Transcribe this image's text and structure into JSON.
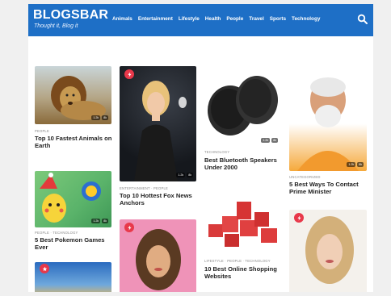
{
  "header": {
    "logo": "BLOGSBAR",
    "tagline": "Thought it, Blog it",
    "nav": [
      "Animals",
      "Entertainment",
      "Lifestyle",
      "Health",
      "People",
      "Travel",
      "Sports",
      "Technology"
    ],
    "search_icon": "search-icon",
    "bg_color": "#1e6fc6"
  },
  "posts": {
    "lion": {
      "category": "PEOPLE",
      "title": "Top 10 Fastest Animals on Earth",
      "likes": "1.2k",
      "views": "8k"
    },
    "pokemon": {
      "category": "PEOPLE · TECHNOLOGY",
      "title": "5 Best Pokemon Games Ever",
      "likes": "1.2k",
      "views": "8k"
    },
    "fox": {
      "category": "ENTERTAINMENT · PEOPLE",
      "title": "Top 10 Hottest Fox News Anchors",
      "likes": "1.2k",
      "views": "8k"
    },
    "speakers": {
      "category": "TECHNOLOGY",
      "title": "Best Bluetooth Speakers Under 2000",
      "likes": "1.2k",
      "views": "8k"
    },
    "shopping": {
      "category": "LIFESTYLE · PEOPLE · TECHNOLOGY",
      "title": "10 Best Online Shopping Websites"
    },
    "modi": {
      "category": "UNCATEGORIZED",
      "title": "5 Best Ways To Contact Prime Minister",
      "likes": "1.2k",
      "views": "8k"
    }
  },
  "colors": {
    "badge": "#e8384a",
    "accent": "#1e6fc6"
  }
}
